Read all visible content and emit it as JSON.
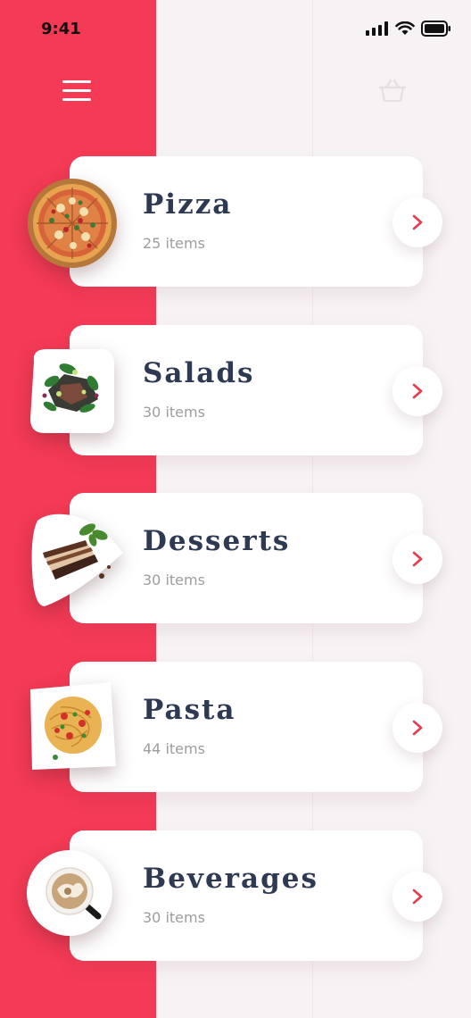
{
  "status_bar": {
    "time": "9:41",
    "icons": [
      "signal-icon",
      "wifi-icon",
      "battery-icon"
    ]
  },
  "header": {
    "menu_icon": "hamburger-menu-icon",
    "cart_icon": "basket-icon"
  },
  "theme": {
    "accent": "#f43a55",
    "background": "#f7f3f5",
    "title_color": "#2e3953",
    "count_color": "#9d9d9d"
  },
  "categories": [
    {
      "name": "Pizza",
      "count": "25 items",
      "image": "pizza-icon"
    },
    {
      "name": "Salads",
      "count": "30 items",
      "image": "salad-icon"
    },
    {
      "name": "Desserts",
      "count": "30 items",
      "image": "cake-slice-icon"
    },
    {
      "name": "Pasta",
      "count": "44 items",
      "image": "spaghetti-icon"
    },
    {
      "name": "Beverages",
      "count": "30 items",
      "image": "coffee-cup-icon"
    }
  ]
}
